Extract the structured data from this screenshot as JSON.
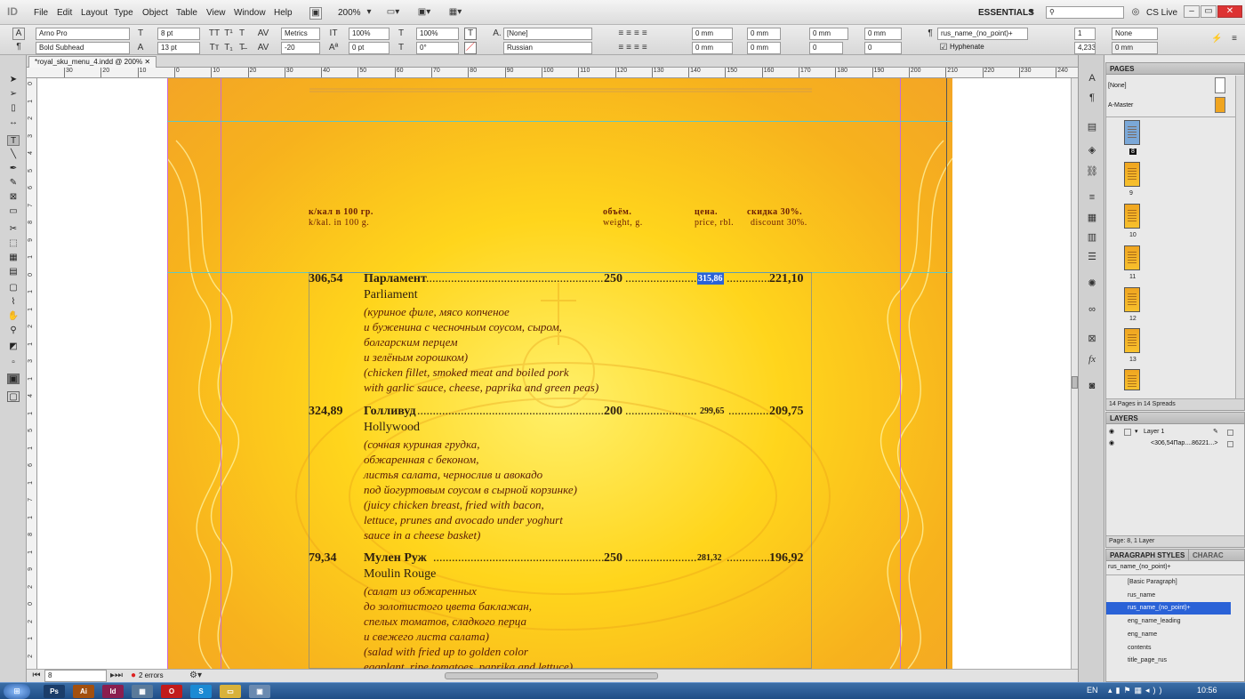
{
  "app": {
    "logo": "ID",
    "menus": [
      "File",
      "Edit",
      "Layout",
      "Type",
      "Object",
      "Table",
      "View",
      "Window",
      "Help"
    ],
    "zoom": "200%",
    "workspace": "ESSENTIALS",
    "cs_live": "CS Live"
  },
  "control": {
    "font_family": "Arno Pro",
    "font_style": "Bold Subhead",
    "font_size": "8 pt",
    "leading": "13 pt",
    "kerning": "Metrics",
    "tracking": "-20",
    "vscale": "100%",
    "hscale": "100%",
    "baseline": "0 pt",
    "skew": "0°",
    "char_style": "[None]",
    "language": "Russian",
    "indent_left": "0 mm",
    "indent_right": "0 mm",
    "space_before": "0 mm",
    "space_after": "0 mm",
    "first_indent": "0 mm",
    "last_indent": "0 mm",
    "drop_lines": "0",
    "drop_chars": "0",
    "para_style": "rus_name_(no_point)+",
    "hyphenate": "Hyphenate",
    "columns": "1",
    "col_width": "4,233",
    "bullets": "None",
    "gutter": "0 mm"
  },
  "document": {
    "tab_title": "*royal_sku_menu_4.indd @ 200%",
    "ruler_h": [
      "30",
      "20",
      "10",
      "0",
      "10",
      "20",
      "30",
      "40",
      "50",
      "60",
      "70",
      "80",
      "90",
      "100",
      "110",
      "120",
      "130",
      "140",
      "150",
      "160",
      "170",
      "180",
      "190",
      "200",
      "210",
      "220",
      "230",
      "240"
    ],
    "ruler_v": [
      "0",
      "1",
      "2",
      "3",
      "4",
      "5",
      "6",
      "7",
      "8",
      "9",
      "1",
      "0",
      "1",
      "1",
      "2",
      "1",
      "3",
      "1",
      "4",
      "1",
      "5",
      "1",
      "6",
      "1",
      "7",
      "1",
      "8",
      "1",
      "9",
      "2",
      "0",
      "2",
      "1",
      "2"
    ]
  },
  "menu": {
    "header": {
      "kcal_ru": "к/кал в 100 гр.",
      "kcal_en": "k/kal. in 100 g.",
      "weight_ru": "объём.",
      "weight_en": "weight, g.",
      "price_ru": "цена.",
      "price_en": "price, rbl.",
      "discount_ru": "скидка 30%.",
      "discount_en": "discount 30%."
    },
    "items": [
      {
        "kcal": "306,54",
        "ru": "Парламент",
        "en": "Parliament",
        "weight": "250",
        "price": "315,86",
        "discount": "221,10",
        "desc": [
          "(куриное филе, мясо копченое",
          "и буженина с чесночным соусом, сыром,",
          "болгарским перцем",
          "и зелёным горошком)",
          "(chicken fillet, smoked meat and boiled pork",
          "with garlic sauce, cheese, paprika and green peas)"
        ]
      },
      {
        "kcal": "324,89",
        "ru": "Голливуд",
        "en": "Hollywood",
        "weight": "200",
        "price": "299,65",
        "discount": "209,75",
        "desc": [
          "(сочная  куриная грудка,",
          "обжаренная с беконом,",
          "листья салата,  чернослив и авокадо",
          "под йогуртовым соусом в сырной корзинке)",
          "(juicy chicken breast, fried with bacon,",
          "lettuce, prunes and avocado under yoghurt",
          "sauce in a cheese basket)"
        ]
      },
      {
        "kcal": "79,34",
        "ru": "Мулен Руж",
        "en": "Moulin Rouge",
        "weight": "250",
        "price": "281,32",
        "discount": "196,92",
        "desc": [
          "(салат из обжаренных",
          "до золотистого цвета баклажан,",
          "спелых томатов, сладкого перца",
          "и свежего листа салата)",
          "(salad with fried up to golden color",
          "eggplant, ripe tomatoes, paprika and lettuce)"
        ]
      }
    ]
  },
  "status": {
    "page": "8",
    "errors": "2 errors"
  },
  "pages_panel": {
    "title": "PAGES",
    "none": "[None]",
    "master": "A-Master",
    "thumbs": [
      "8",
      "9",
      "10",
      "11",
      "12",
      "13"
    ],
    "footer": "14 Pages in 14 Spreads"
  },
  "layers_panel": {
    "title": "LAYERS",
    "layer": "Layer 1",
    "sublayer": "<306,54Пар....86221...>",
    "footer": "Page: 8, 1 Layer"
  },
  "styles_panel": {
    "title": "PARAGRAPH STYLES",
    "tab2": "CHARAC",
    "current": "rus_name_(no_point)+",
    "items": [
      "[Basic Paragraph]",
      "rus_name",
      "rus_name_(no_point)+",
      "eng_name_leading",
      "eng_name",
      "contents",
      "title_page_rus"
    ],
    "active_index": 2
  },
  "taskbar": {
    "lang": "EN",
    "time": "10:56",
    "apps": [
      "Ps",
      "Ai",
      "Id",
      "O",
      "S"
    ]
  },
  "colors": {
    "accent": "#2a62d7",
    "page_gold": "#f7b21d",
    "text_brown": "#2f2010",
    "desc_red": "#5a1b06"
  }
}
